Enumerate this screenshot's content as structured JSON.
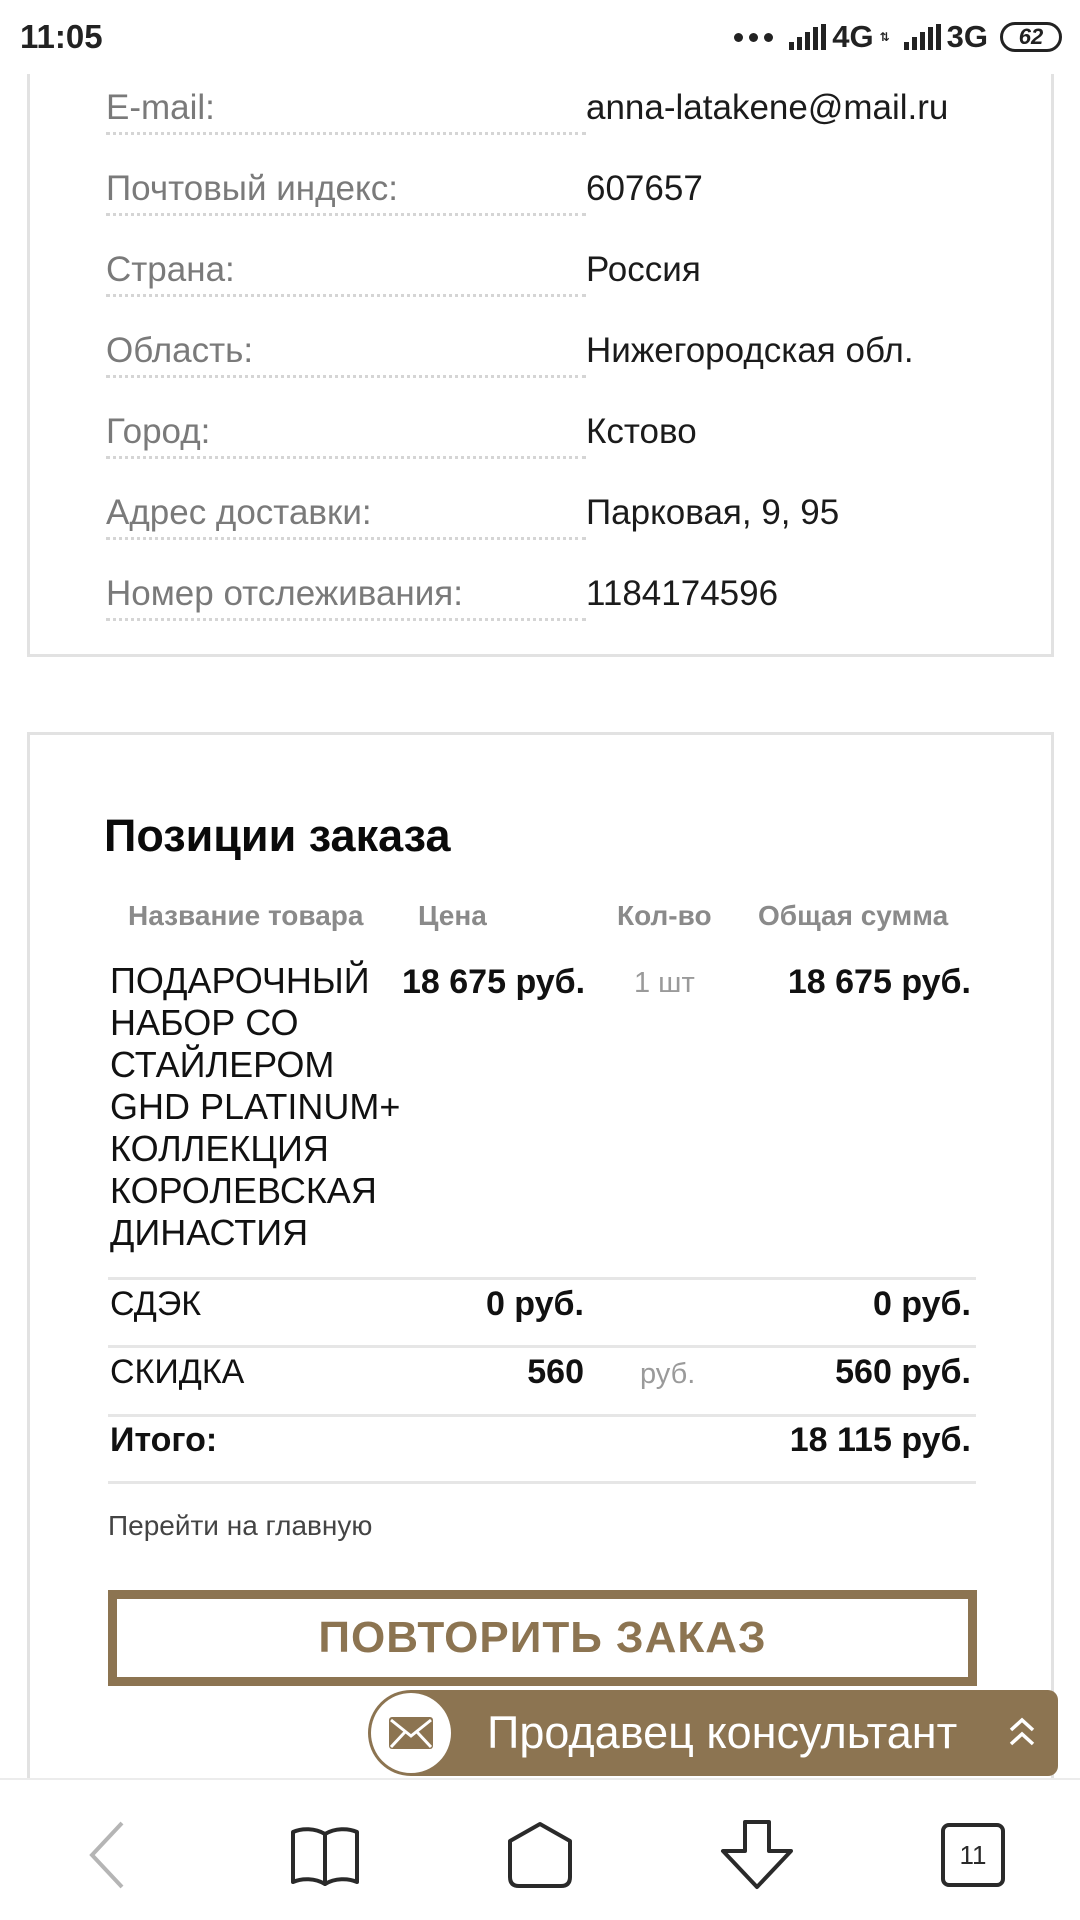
{
  "status_bar": {
    "time": "11:05",
    "network_1": "4G",
    "network_1_sub": "⇅",
    "network_2": "3G",
    "battery": "62"
  },
  "address": {
    "rows": [
      {
        "label": "E-mail:",
        "value": "anna-latakene@mail.ru"
      },
      {
        "label": "Почтовый индекс:",
        "value": "607657"
      },
      {
        "label": "Страна:",
        "value": "Россия"
      },
      {
        "label": "Область:",
        "value": "Нижегородская обл."
      },
      {
        "label": "Город:",
        "value": "Кстово"
      },
      {
        "label": "Адрес доставки:",
        "value": "Парковая, 9, 95"
      },
      {
        "label": "Номер отслеживания:",
        "value": "1184174596"
      }
    ]
  },
  "order": {
    "title": "Позиции заказа",
    "headers": {
      "name": "Название товара",
      "price": "Цена",
      "qty": "Кол-во",
      "total": "Общая сумма"
    },
    "product": {
      "name": "ПОДАРОЧНЫЙ НАБОР СО СТАЙЛЕРОМ GHD PLATINUM+ КОЛЛЕКЦИЯ КОРОЛЕВСКАЯ ДИНАСТИЯ",
      "price": "18 675 руб.",
      "qty": "1 шт",
      "total": "18 675 руб."
    },
    "delivery": {
      "name": "СДЭК",
      "price": "0 руб.",
      "total": "0 руб."
    },
    "discount": {
      "name": "СКИДКА",
      "price": "560",
      "unit": "руб.",
      "total": "560 руб."
    },
    "grand_total": {
      "label": "Итого:",
      "value": "18 115 руб."
    },
    "home_link": "Перейти на главную",
    "repeat_button": "ПОВТОРИТЬ ЗАКАЗ"
  },
  "consultant": {
    "label": "Продавец консультант",
    "icon": "mail-icon"
  },
  "bottom_nav": {
    "tabs_count": "11"
  },
  "colors": {
    "accent": "#8c7451",
    "border": "#e2e2e2",
    "label": "#7a7a7a"
  }
}
